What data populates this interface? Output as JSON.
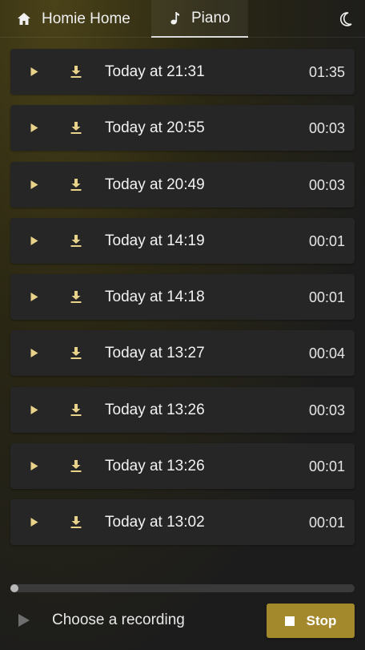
{
  "nav": {
    "home_label": "Homie Home",
    "piano_label": "Piano",
    "home_icon": "home-icon",
    "piano_icon": "music-note-icon",
    "theme_icon": "moon-icon"
  },
  "recordings": [
    {
      "when": "Today at 21:31",
      "duration": "01:35"
    },
    {
      "when": "Today at 20:55",
      "duration": "00:03"
    },
    {
      "when": "Today at 20:49",
      "duration": "00:03"
    },
    {
      "when": "Today at 14:19",
      "duration": "00:01"
    },
    {
      "when": "Today at 14:18",
      "duration": "00:01"
    },
    {
      "when": "Today at 13:27",
      "duration": "00:04"
    },
    {
      "when": "Today at 13:26",
      "duration": "00:03"
    },
    {
      "when": "Today at 13:26",
      "duration": "00:01"
    },
    {
      "when": "Today at 13:02",
      "duration": "00:01"
    }
  ],
  "player": {
    "placeholder": "Choose a recording",
    "stop_label": "Stop",
    "progress": 0
  },
  "colors": {
    "accent": "#a3892c",
    "icon_gold": "#e9d38a",
    "row_bg": "#262626"
  }
}
